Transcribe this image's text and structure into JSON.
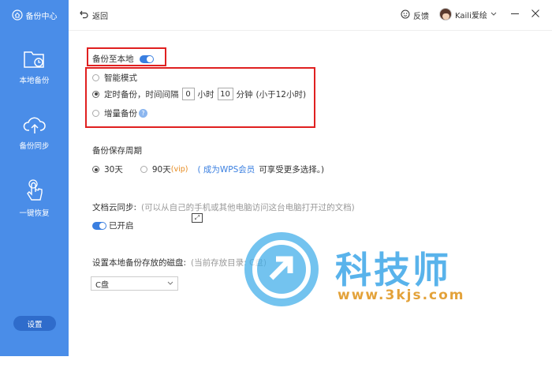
{
  "sidebar": {
    "title": "备份中心",
    "items": [
      {
        "label": "本地备份",
        "icon": "folder-clock-icon"
      },
      {
        "label": "备份同步",
        "icon": "cloud-upload-icon"
      },
      {
        "label": "一键恢复",
        "icon": "hand-tap-icon"
      }
    ],
    "settings_label": "设置"
  },
  "topbar": {
    "back_label": "返回",
    "feedback_label": "反馈",
    "user_name": "Kaili爱绘"
  },
  "local_backup": {
    "title": "备份至本地",
    "smart_mode": "智能模式",
    "timed_prefix": "定时备份，时间间隔",
    "hours_value": "0",
    "hours_unit": "小时",
    "minutes_value": "10",
    "minutes_unit": "分钟",
    "timed_note": "(小于12小时)",
    "incremental": "增量备份",
    "help_glyph": "?"
  },
  "retention": {
    "title": "备份保存周期",
    "opt1": "30天",
    "opt2": "90天",
    "vip_tag": "(vip)",
    "upgrade_link": "( 成为WPS会员",
    "upgrade_suffix": "可享受更多选择。)"
  },
  "cloud_sync": {
    "title": "文档云同步:",
    "desc": "(可以从自己的手机或其他电脑访问这台电脑打开过的文档)",
    "status": "已开启"
  },
  "disk": {
    "title": "设置本地备份存放的磁盘:",
    "current_hint": "(当前存放目录: C盘)",
    "selected": "C盘"
  },
  "watermark": {
    "text": "科技师",
    "url": "www.3kjs.com"
  },
  "colors": {
    "sidebar": "#4a8de8",
    "accent": "#3a7fe0",
    "highlight_box": "#e02020"
  }
}
